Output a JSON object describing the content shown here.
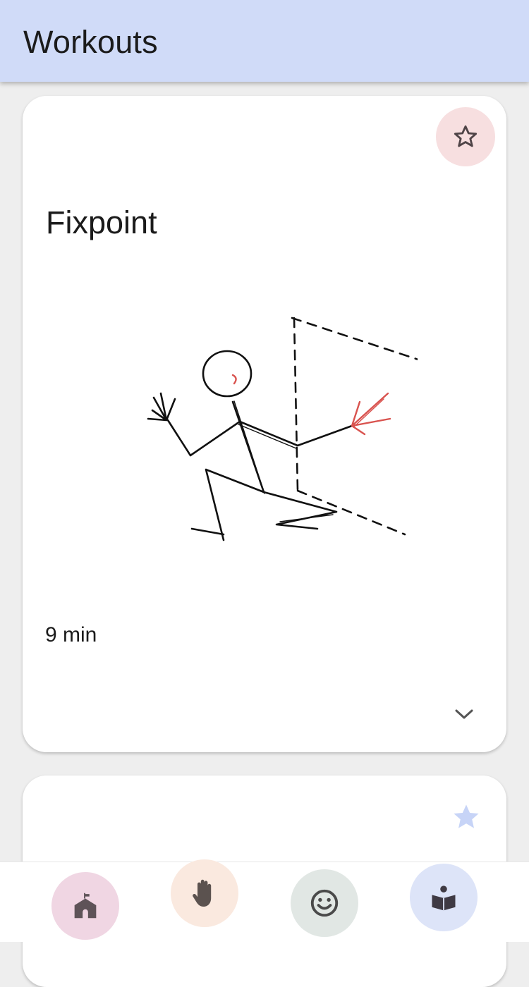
{
  "app_bar": {
    "title": "Workouts"
  },
  "cards": [
    {
      "title": "Fixpoint",
      "duration": "9 min",
      "favorite_icon": "star-outline-icon",
      "favorited": false,
      "expand_icon": "chevron-down-icon"
    },
    {
      "favorite_icon": "star-filled-icon",
      "favorited": true
    }
  ],
  "bottom_nav": {
    "items": [
      {
        "icon": "school-home-icon",
        "bg": "#f0d6e3"
      },
      {
        "icon": "hand-icon",
        "bg": "#fae9df"
      },
      {
        "icon": "smiley-icon",
        "bg": "#e1e7e4"
      },
      {
        "icon": "reading-person-icon",
        "bg": "#dde4f8"
      }
    ]
  },
  "colors": {
    "app_bar_bg": "#d0dbf8",
    "background": "#eeeeee",
    "card_bg": "#ffffff",
    "favorite_bg": "#f7dfe0",
    "star_filled": "#c7d4f7",
    "sketch_accent": "#d9534f",
    "icon_dark": "#5e5358"
  }
}
